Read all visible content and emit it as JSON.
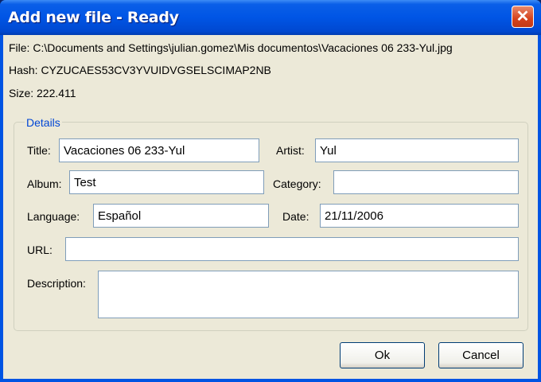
{
  "window": {
    "title": "Add new file - Ready",
    "close": "✕"
  },
  "info": {
    "file": "File: C:\\Documents and Settings\\julian.gomez\\Mis documentos\\Vacaciones 06 233-Yul.jpg",
    "hash": "Hash: CYZUCAES53CV3YVUIDVGSELSCIMAP2NB",
    "size": "Size: 222.411"
  },
  "details": {
    "legend": "Details",
    "title_label": "Title:",
    "title_value": "Vacaciones 06 233-Yul",
    "artist_label": "Artist:",
    "artist_value": "Yul",
    "album_label": "Album:",
    "album_value": "Test",
    "category_label": "Category:",
    "category_value": "",
    "language_label": "Language:",
    "language_value": "Español",
    "date_label": "Date:",
    "date_value": "21/11/2006",
    "url_label": "URL:",
    "url_value": "",
    "description_label": "Description:",
    "description_value": ""
  },
  "buttons": {
    "ok": "Ok",
    "cancel": "Cancel"
  }
}
